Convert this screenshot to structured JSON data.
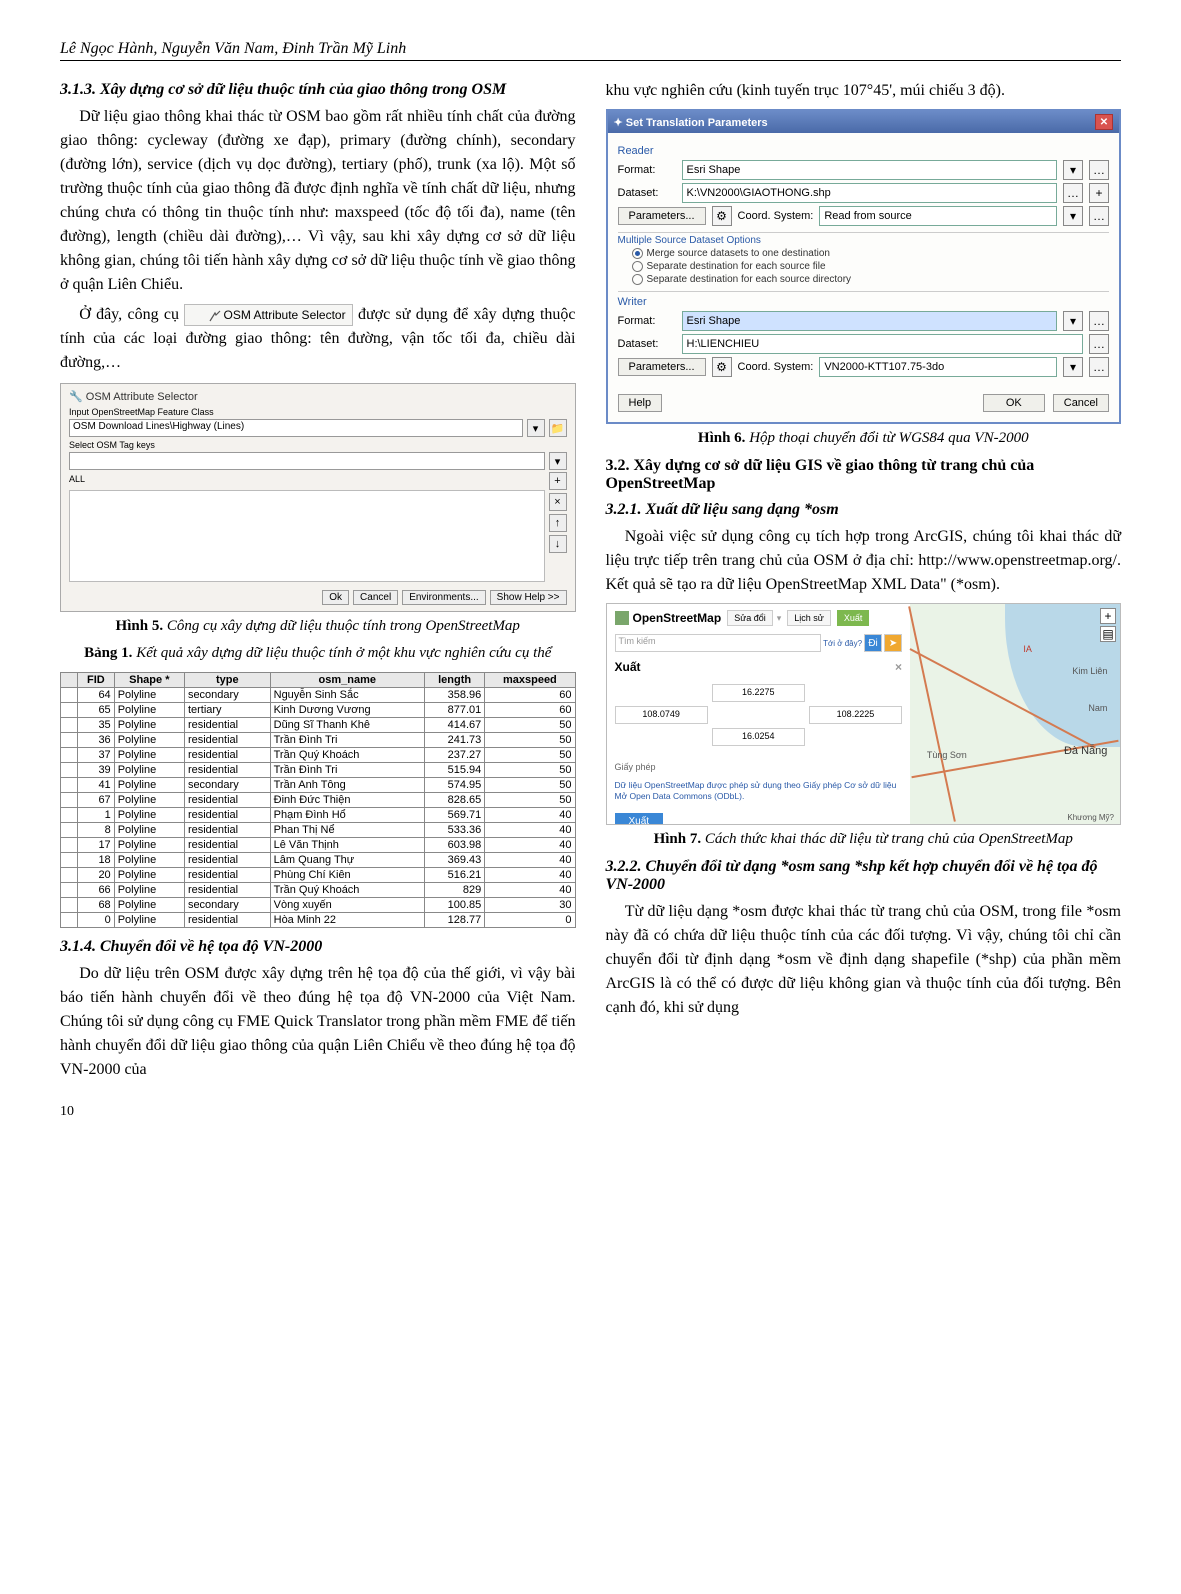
{
  "header": {
    "authors": "Lê Ngọc Hành, Nguyễn Văn Nam, Đinh Trần Mỹ Linh"
  },
  "left": {
    "h313": "3.1.3. Xây dựng cơ sở dữ liệu thuộc tính của giao thông trong OSM",
    "p1": "Dữ liệu giao thông khai thác từ OSM bao gồm rất nhiều tính chất của đường giao thông: cycleway (đường xe đạp), primary (đường chính), secondary (đường lớn), service (dịch vụ dọc đường), tertiary (phố), trunk (xa lộ). Một số trường thuộc tính của giao thông đã được định nghĩa về tính chất dữ liệu, nhưng chúng chưa có thông tin thuộc tính như: maxspeed (tốc độ tối đa), name (tên đường), length (chiều dài đường),… Vì vậy, sau khi xây dựng cơ sở dữ liệu không gian, chúng tôi tiến hành xây dựng cơ sở dữ liệu thuộc tính về giao thông ở quận Liên Chiểu.",
    "p2a": "Ở đây, công cụ ",
    "tool_label": "OSM Attribute Selector",
    "p2b": " được sử dụng để xây dựng thuộc tính của các loại đường giao thông: tên đường, vận tốc tối đa, chiều dài đường,…",
    "fig5": {
      "title": "OSM Attribute Selector",
      "row1": "Input OpenStreetMap Feature Class",
      "row2": "OSM Download Lines\\Highway (Lines)",
      "row3": "Select OSM Tag keys",
      "all": "ALL",
      "ok": "Ok",
      "cancel": "Cancel",
      "env": "Environments...",
      "help": "Show Help >>"
    },
    "cap5_b": "Hình 5.",
    "cap5": " Công cụ xây dựng dữ liệu thuộc tính trong OpenStreetMap",
    "tab1_b": "Bảng 1.",
    "tab1": " Kết quả xây dựng dữ liệu thuộc tính ở một khu vực nghiên cứu cụ thể",
    "table": {
      "headers": [
        "FID",
        "Shape *",
        "type",
        "osm_name",
        "length",
        "maxspeed"
      ],
      "rows": [
        [
          "64",
          "Polyline",
          "secondary",
          "Nguyễn Sinh Sắc",
          "358.96",
          "60"
        ],
        [
          "65",
          "Polyline",
          "tertiary",
          "Kinh Dương Vương",
          "877.01",
          "60"
        ],
        [
          "35",
          "Polyline",
          "residential",
          "Dũng Sĩ Thanh Khê",
          "414.67",
          "50"
        ],
        [
          "36",
          "Polyline",
          "residential",
          "Trần Đình Tri",
          "241.73",
          "50"
        ],
        [
          "37",
          "Polyline",
          "residential",
          "Trần Quý Khoách",
          "237.27",
          "50"
        ],
        [
          "39",
          "Polyline",
          "residential",
          "Trần Đình Tri",
          "515.94",
          "50"
        ],
        [
          "41",
          "Polyline",
          "secondary",
          "Trần Anh Tông",
          "574.95",
          "50"
        ],
        [
          "67",
          "Polyline",
          "residential",
          "Đinh Đức Thiện",
          "828.65",
          "50"
        ],
        [
          "1",
          "Polyline",
          "residential",
          "Phạm Đình Hổ",
          "569.71",
          "40"
        ],
        [
          "8",
          "Polyline",
          "residential",
          "Phan Thị Nể",
          "533.36",
          "40"
        ],
        [
          "17",
          "Polyline",
          "residential",
          "Lê Văn Thịnh",
          "603.98",
          "40"
        ],
        [
          "18",
          "Polyline",
          "residential",
          "Lâm Quang Thự",
          "369.43",
          "40"
        ],
        [
          "20",
          "Polyline",
          "residential",
          "Phùng Chí Kiên",
          "516.21",
          "40"
        ],
        [
          "66",
          "Polyline",
          "residential",
          "Trần Quý Khoách",
          "829",
          "40"
        ],
        [
          "68",
          "Polyline",
          "secondary",
          "Vòng xuyến",
          "100.85",
          "30"
        ],
        [
          "0",
          "Polyline",
          "residential",
          "Hòa Minh 22",
          "128.77",
          "0"
        ]
      ]
    },
    "h314": "3.1.4. Chuyển đổi về hệ tọa độ VN-2000",
    "p3": "Do dữ liệu trên OSM được xây dựng trên hệ tọa độ của thế giới, vì vậy bài báo tiến hành chuyển đổi về theo đúng hệ tọa độ VN-2000 của Việt Nam. Chúng tôi sử dụng công cụ FME Quick Translator trong phần mềm FME để tiến hành chuyển đổi dữ liệu giao thông của quận Liên Chiểu về theo đúng hệ tọa độ VN-2000 của"
  },
  "right": {
    "p0": "khu vực nghiên cứu (kinh tuyến trục 107°45', múi chiếu 3 độ).",
    "dlg": {
      "title": "Set Translation Parameters",
      "reader": "Reader",
      "format": "Format:",
      "format_v": "Esri Shape",
      "dataset": "Dataset:",
      "dataset_v": "K:\\VN2000\\GIAOTHONG.shp",
      "params": "Parameters...",
      "coord": "Coord. System:",
      "coord_v": "Read from source",
      "mso": "Multiple Source Dataset Options",
      "opt1": "Merge source datasets to one destination",
      "opt2": "Separate destination for each source file",
      "opt3": "Separate destination for each source directory",
      "writer": "Writer",
      "wformat_v": "Esri Shape",
      "wdataset_v": "H:\\LIENCHIEU",
      "wcoord_v": "VN2000-KTT107.75-3do",
      "help": "Help",
      "ok": "OK",
      "cancel": "Cancel"
    },
    "cap6_b": "Hình 6.",
    "cap6": " Hộp thoại chuyển đổi từ WGS84 qua VN-2000",
    "h32": "3.2. Xây dựng cơ sở dữ liệu GIS về giao thông từ trang chủ của OpenStreetMap",
    "h321": "3.2.1. Xuất dữ liệu sang dạng *osm",
    "p1": "Ngoài việc sử dụng công cụ tích hợp trong ArcGIS, chúng tôi khai thác dữ liệu trực tiếp trên trang chủ của OSM ở địa chỉ: http://www.openstreetmap.org/. Kết quả sẽ tạo ra dữ liệu OpenStreetMap XML Data\" (*osm).",
    "osm": {
      "logo": "OpenStreetMap",
      "tab_edit": "Sửa đổi",
      "tab_hist": "Lịch sử",
      "tab_export": "Xuất",
      "search_ph": "Tìm kiếm",
      "where": "Tới ở đây?",
      "go": "Đi",
      "export": "Xuất",
      "n": "16.2275",
      "w": "108.0749",
      "e": "108.2225",
      "s": "16.0254",
      "gp": "Giấy phép",
      "note": "Dữ liệu OpenStreetMap được phép sử dụng theo Giấy phép Cơ sở dữ liệu Mở Open Data Commons (ODbL).",
      "export_btn": "Xuất",
      "place1": "IA",
      "place2": "Kim Liên",
      "place3": "Nam",
      "place4": "Tùng Sơn",
      "place5": "Đà Nẵng",
      "place6": "Khương Mỹ?"
    },
    "cap7_b": "Hình 7.",
    "cap7": " Cách thức khai thác dữ liệu từ trang chủ của OpenStreetMap",
    "h322": "3.2.2. Chuyển đổi từ dạng *osm sang *shp kết hợp chuyển đổi về hệ tọa độ VN-2000",
    "p2": "Từ dữ liệu dạng *osm được khai thác từ trang chủ của OSM, trong file *osm này đã có chứa dữ liệu thuộc tính của các đối tượng. Vì vậy, chúng tôi chỉ cần chuyển đổi từ định dạng *osm về định dạng shapefile (*shp) của phần mềm ArcGIS là có thể có được dữ liệu không gian và thuộc tính của đối tượng. Bên cạnh đó, khi sử dụng"
  },
  "page": "10"
}
